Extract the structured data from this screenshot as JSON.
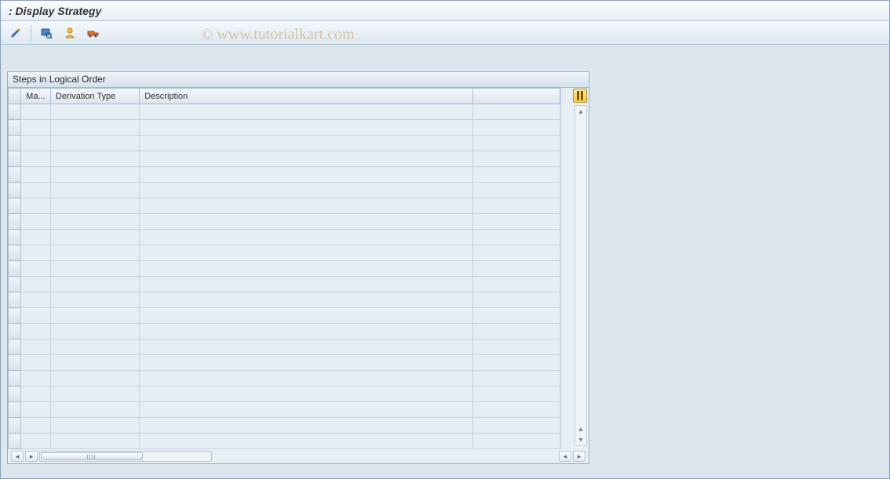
{
  "titlebar": {
    "text": ": Display Strategy"
  },
  "toolbar": {
    "icons": [
      "edit-icon",
      "inspect-icon",
      "user-icon",
      "transport-icon"
    ]
  },
  "watermark": "© www.tutorialkart.com",
  "panel": {
    "title": "Steps in Logical Order",
    "columns": {
      "ma": "Ma...",
      "derivation": "Derivation Type",
      "description": "Description"
    },
    "rows": [
      {
        "ma": "",
        "derivation": "",
        "description": ""
      },
      {
        "ma": "",
        "derivation": "",
        "description": ""
      },
      {
        "ma": "",
        "derivation": "",
        "description": ""
      },
      {
        "ma": "",
        "derivation": "",
        "description": ""
      },
      {
        "ma": "",
        "derivation": "",
        "description": ""
      },
      {
        "ma": "",
        "derivation": "",
        "description": ""
      },
      {
        "ma": "",
        "derivation": "",
        "description": ""
      },
      {
        "ma": "",
        "derivation": "",
        "description": ""
      },
      {
        "ma": "",
        "derivation": "",
        "description": ""
      },
      {
        "ma": "",
        "derivation": "",
        "description": ""
      },
      {
        "ma": "",
        "derivation": "",
        "description": ""
      },
      {
        "ma": "",
        "derivation": "",
        "description": ""
      },
      {
        "ma": "",
        "derivation": "",
        "description": ""
      },
      {
        "ma": "",
        "derivation": "",
        "description": ""
      },
      {
        "ma": "",
        "derivation": "",
        "description": ""
      },
      {
        "ma": "",
        "derivation": "",
        "description": ""
      },
      {
        "ma": "",
        "derivation": "",
        "description": ""
      },
      {
        "ma": "",
        "derivation": "",
        "description": ""
      },
      {
        "ma": "",
        "derivation": "",
        "description": ""
      },
      {
        "ma": "",
        "derivation": "",
        "description": ""
      },
      {
        "ma": "",
        "derivation": "",
        "description": ""
      },
      {
        "ma": "",
        "derivation": "",
        "description": ""
      }
    ]
  }
}
